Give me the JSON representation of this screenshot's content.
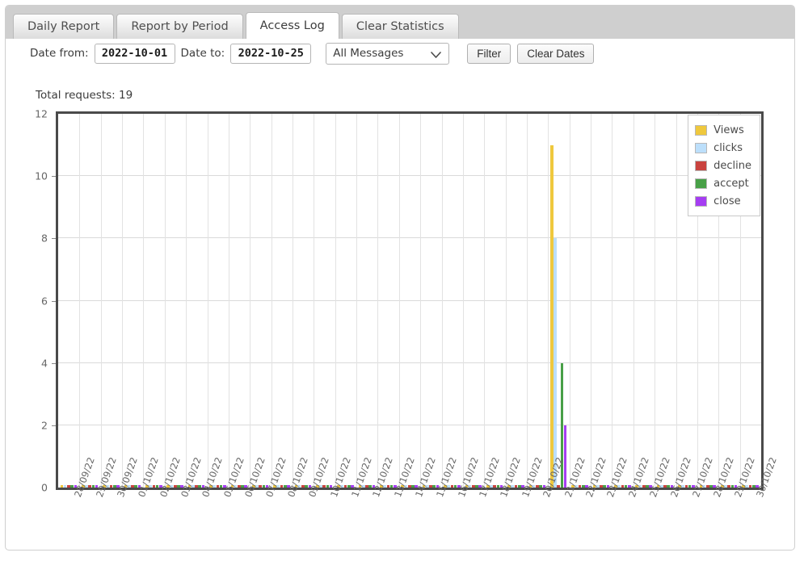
{
  "window": {
    "title": "Access Log"
  },
  "tabs": [
    {
      "label": "Daily Report",
      "active": false
    },
    {
      "label": "Report by Period",
      "active": false
    },
    {
      "label": "Access Log",
      "active": true
    },
    {
      "label": "Clear Statistics",
      "active": false
    }
  ],
  "toolbar": {
    "date_from_label": "Date from:",
    "date_from_value": "2022-10-01",
    "date_to_label": "Date to:",
    "date_to_value": "2022-10-25",
    "message_filter_selected": "All Messages",
    "message_filter_options": [
      "All Messages"
    ],
    "filter_button": "Filter",
    "clear_dates_button": "Clear Dates",
    "chevron_icon": "chevron-down-icon"
  },
  "summary": {
    "total_requests_label": "Total requests: 19"
  },
  "chart_data": {
    "type": "bar",
    "title": "",
    "xlabel": "",
    "ylabel": "",
    "ylim": [
      0,
      12
    ],
    "yticks": [
      0,
      2,
      4,
      6,
      8,
      10,
      12
    ],
    "grid": true,
    "legend_position": "top-right",
    "categories": [
      "28/09/22",
      "29/09/22",
      "30/09/22",
      "01/10/22",
      "02/10/22",
      "03/10/22",
      "04/10/22",
      "05/10/22",
      "06/10/22",
      "07/10/22",
      "08/10/22",
      "09/10/22",
      "10/10/22",
      "11/10/22",
      "12/10/22",
      "13/10/22",
      "14/10/22",
      "15/10/22",
      "16/10/22",
      "17/10/22",
      "18/10/22",
      "19/10/22",
      "20/10/22",
      "21/10/22",
      "22/10/22",
      "23/10/22",
      "24/10/22",
      "25/10/22",
      "26/10/22",
      "27/10/22",
      "28/10/22",
      "29/10/22",
      "30/10/22"
    ],
    "series": [
      {
        "name": "Views",
        "color": "#efc83d",
        "values": [
          0,
          0,
          0,
          0,
          0,
          0,
          0,
          0,
          0,
          0,
          0,
          0,
          0,
          0,
          0,
          0,
          0,
          0,
          0,
          0,
          0,
          0,
          0,
          11,
          0,
          0,
          0,
          0,
          0,
          0,
          0,
          0,
          0
        ]
      },
      {
        "name": "clicks",
        "color": "#bcdffb",
        "values": [
          0,
          0,
          0,
          0,
          0,
          0,
          0,
          0,
          0,
          0,
          0,
          0,
          0,
          0,
          0,
          0,
          0,
          0,
          0,
          0,
          0,
          0,
          0,
          8,
          0,
          0,
          0,
          0,
          0,
          0,
          0,
          0,
          0
        ]
      },
      {
        "name": "decline",
        "color": "#c9433f",
        "values": [
          0,
          0,
          0,
          0,
          0,
          0,
          0,
          0,
          0,
          0,
          0,
          0,
          0,
          0,
          0,
          0,
          0,
          0,
          0,
          0,
          0,
          0,
          0,
          0,
          0,
          0,
          0,
          0,
          0,
          0,
          0,
          0,
          0
        ]
      },
      {
        "name": "accept",
        "color": "#48a047",
        "values": [
          0,
          0,
          0,
          0,
          0,
          0,
          0,
          0,
          0,
          0,
          0,
          0,
          0,
          0,
          0,
          0,
          0,
          0,
          0,
          0,
          0,
          0,
          0,
          4,
          0,
          0,
          0,
          0,
          0,
          0,
          0,
          0,
          0
        ]
      },
      {
        "name": "close",
        "color": "#a53df2",
        "values": [
          0,
          0,
          0,
          0,
          0,
          0,
          0,
          0,
          0,
          0,
          0,
          0,
          0,
          0,
          0,
          0,
          0,
          0,
          0,
          0,
          0,
          0,
          0,
          2,
          0,
          0,
          0,
          0,
          0,
          0,
          0,
          0,
          0
        ]
      }
    ]
  }
}
